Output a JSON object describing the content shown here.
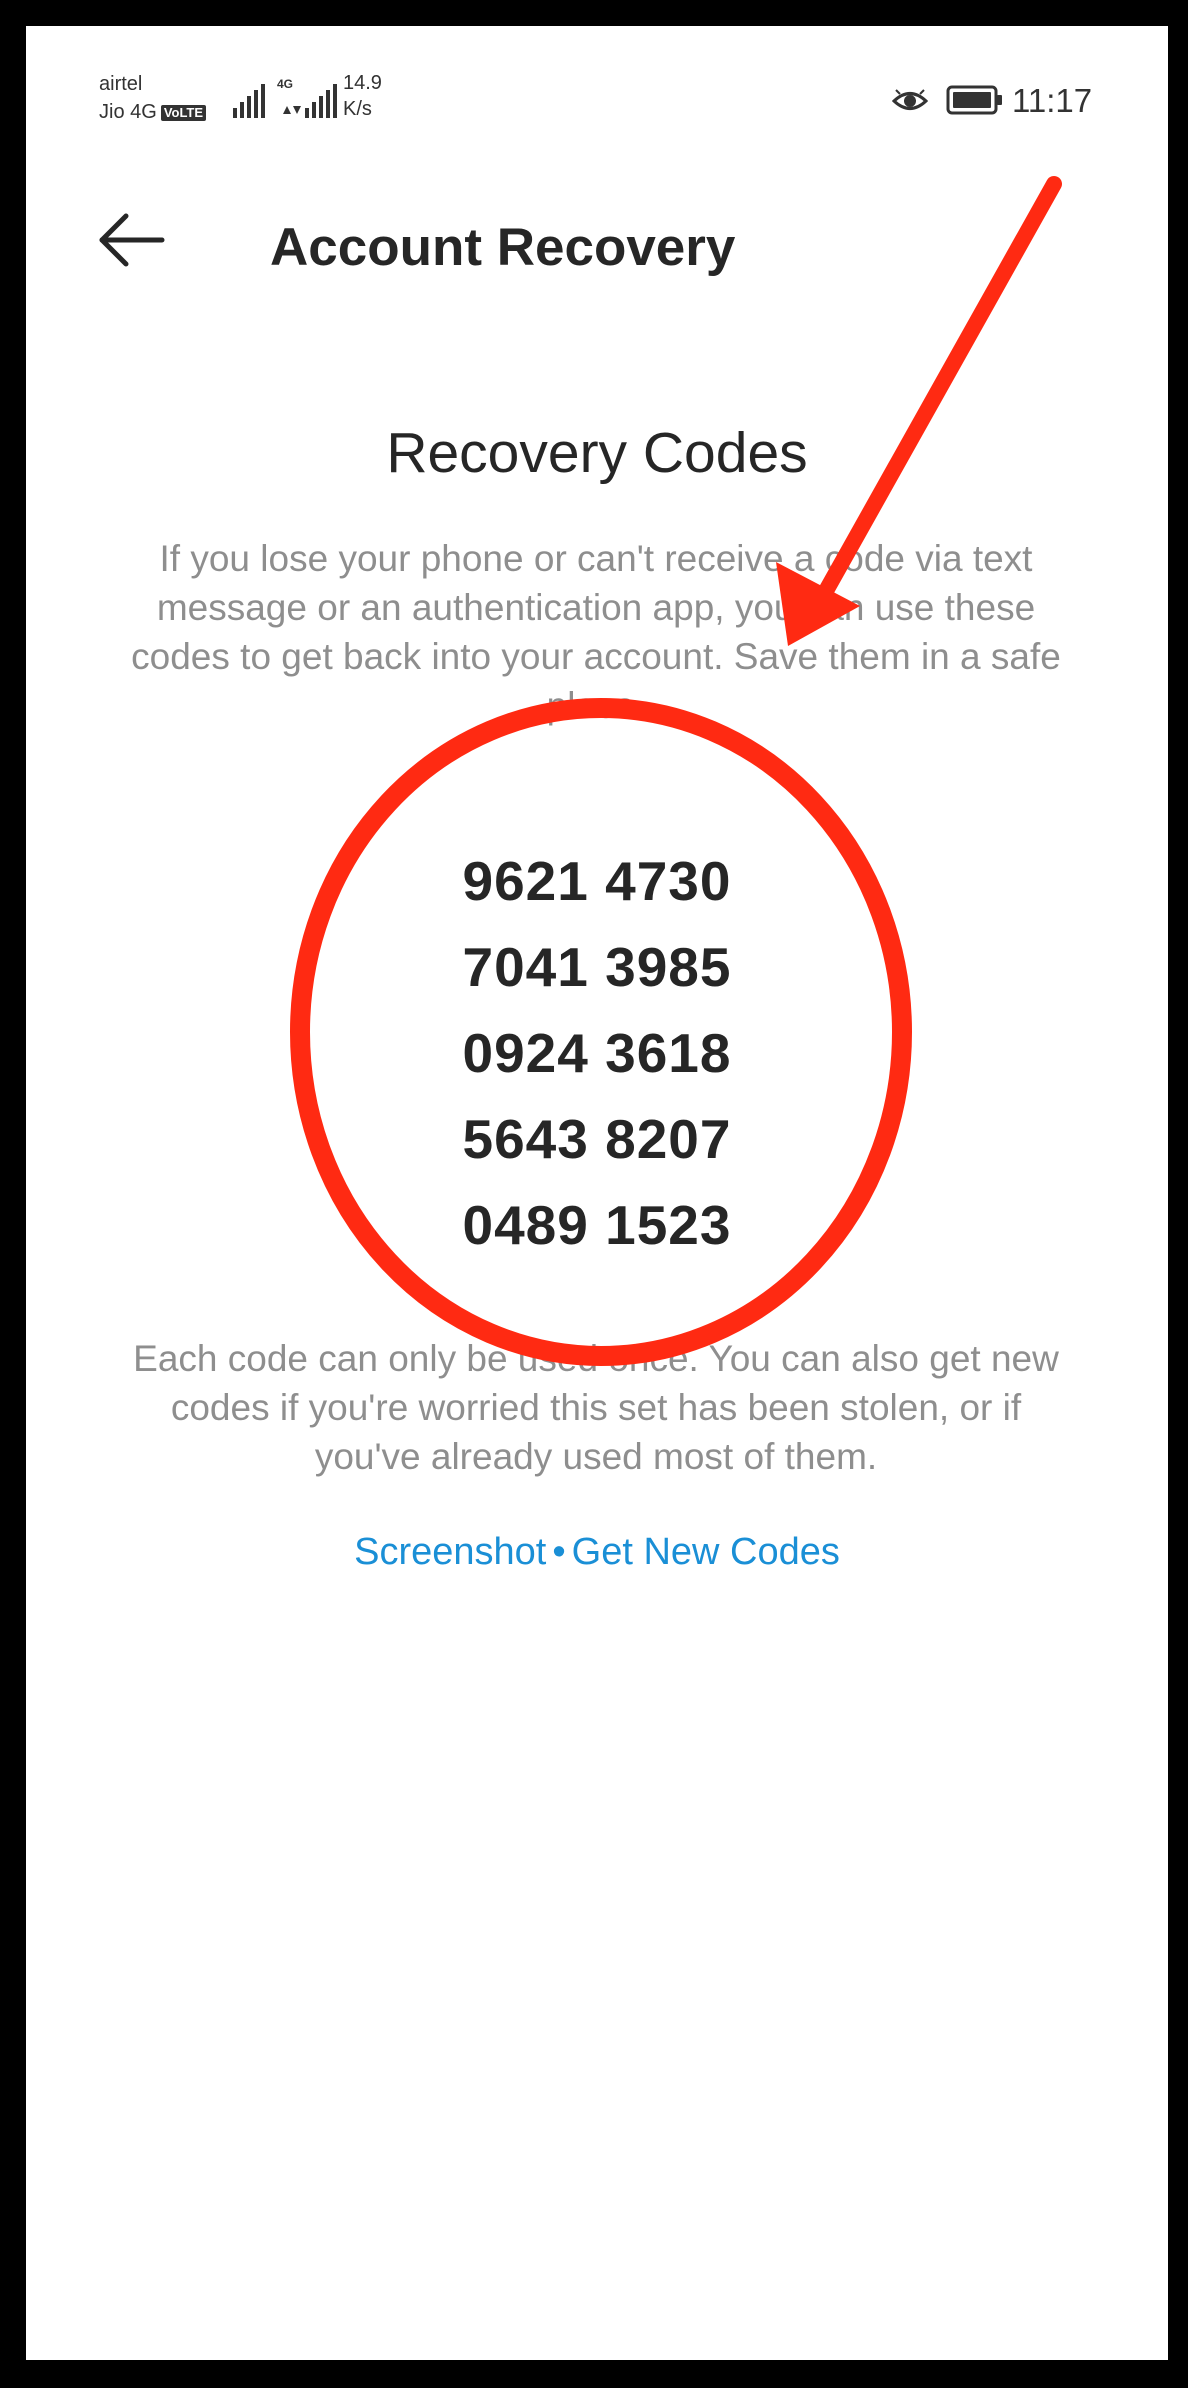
{
  "status_bar": {
    "carrier_1": "airtel",
    "carrier_2": "Jio 4G",
    "volte_badge": "VoLTE",
    "network_type": "4G",
    "net_speed_value": "14.9",
    "net_speed_unit": "K/s",
    "clock": "11:17",
    "icons": [
      "signal-icon",
      "signal-icon",
      "eye-icon",
      "battery-icon"
    ]
  },
  "header": {
    "title": "Account Recovery",
    "back_icon": "arrow-left-icon"
  },
  "main": {
    "heading": "Recovery Codes",
    "intro": "If you lose your phone or can't receive a code via text message or an authentication app, you can use these codes to get back into your account. Save them in a safe place.",
    "codes": [
      "9621 4730",
      "7041 3985",
      "0924 3618",
      "5643 8207",
      "0489 1523"
    ],
    "footer": "Each code can only be used once. You can also get new codes if you're worried this set has been stolen, or if you've already used most of them.",
    "links": {
      "screenshot": "Screenshot",
      "separator": "•",
      "get_new_codes": "Get New Codes"
    }
  },
  "colors": {
    "title_text": "#262626",
    "secondary_text": "#8e8e8e",
    "link": "#1a8fd6",
    "annotation_red": "#ff2a12",
    "frame_border": "#000000"
  }
}
